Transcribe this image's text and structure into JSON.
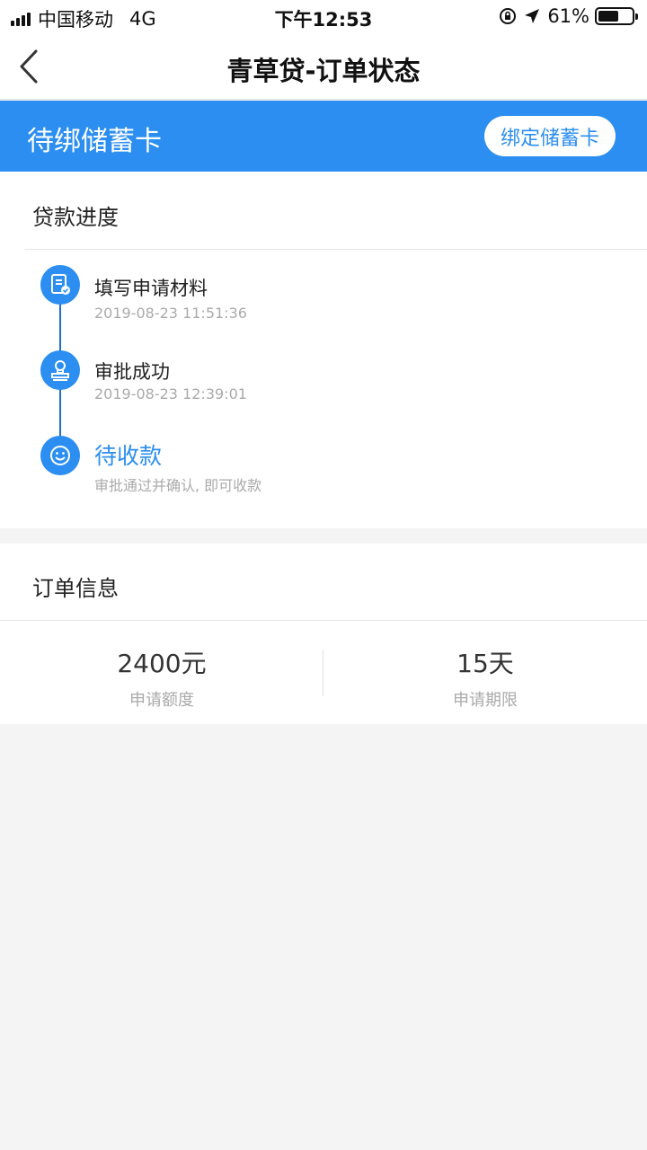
{
  "status_bar": {
    "carrier": "中国移动",
    "network": "4G",
    "time": "下午12:53",
    "battery_percent": "61%",
    "battery_level": 0.61
  },
  "nav": {
    "title": "青草贷-订单状态"
  },
  "banner": {
    "title": "待绑储蓄卡",
    "button_label": "绑定储蓄卡",
    "color": "#2b8ef0"
  },
  "progress": {
    "title": "贷款进度",
    "steps": [
      {
        "title": "填写申请材料",
        "subtitle": "2019-08-23 11:51:36",
        "icon": "document-check-icon"
      },
      {
        "title": "审批成功",
        "subtitle": "2019-08-23 12:39:01",
        "icon": "stamp-icon"
      },
      {
        "title": "待收款",
        "subtitle": "审批通过并确认, 即可收款",
        "icon": "smiley-icon"
      }
    ]
  },
  "order": {
    "title": "订单信息",
    "amount_value": "2400元",
    "amount_label": "申请额度",
    "term_value": "15天",
    "term_label": "申请期限"
  }
}
